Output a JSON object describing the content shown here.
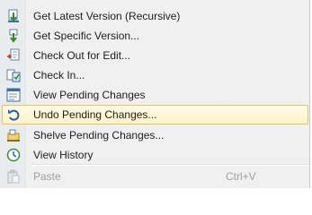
{
  "menu": {
    "items": [
      {
        "label": "Get Latest Version (Recursive)",
        "icon": "get-latest-icon"
      },
      {
        "label": "Get Specific Version...",
        "icon": "get-specific-version-icon"
      },
      {
        "label": "Check Out for Edit...",
        "icon": "check-out-icon"
      },
      {
        "label": "Check In...",
        "icon": "check-in-icon"
      },
      {
        "label": "View Pending Changes",
        "icon": "pending-changes-icon"
      },
      {
        "label": "Undo Pending Changes...",
        "icon": "undo-icon",
        "highlighted": true
      },
      {
        "label": "Shelve Pending Changes...",
        "icon": "shelve-icon"
      },
      {
        "label": "View History",
        "icon": "history-icon"
      },
      {
        "label": "Paste",
        "shortcut": "Ctrl+V",
        "icon": "paste-icon",
        "disabled": true
      }
    ]
  },
  "colors": {
    "highlight_border": "#e5c365",
    "highlight_fill": "#fff3c6",
    "gutter": "#e9ecef",
    "disabled_text": "#a0a0a0"
  }
}
